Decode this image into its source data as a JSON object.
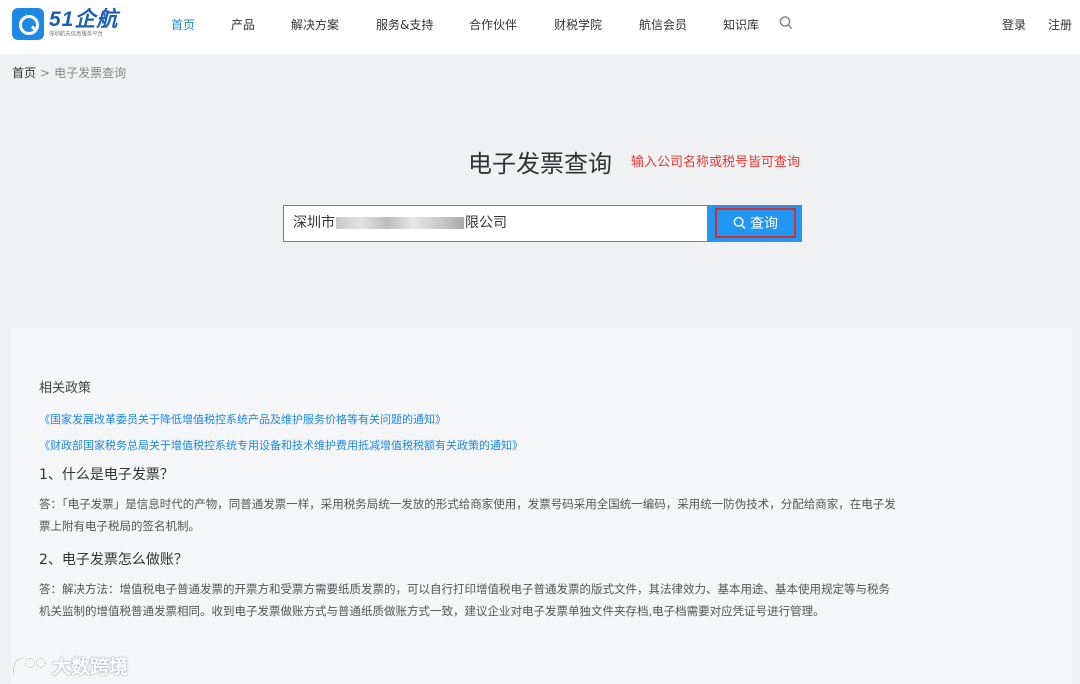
{
  "header": {
    "logo": {
      "name": "51企航",
      "subtitle": "深圳航天信息服务平台"
    },
    "nav": [
      {
        "label": "首页",
        "active": true
      },
      {
        "label": "产品"
      },
      {
        "label": "解决方案"
      },
      {
        "label": "服务&支持"
      },
      {
        "label": "合作伙伴"
      },
      {
        "label": "财税学院"
      },
      {
        "label": "航信会员"
      },
      {
        "label": "知识库"
      }
    ],
    "login_label": "登录",
    "register_label": "注册"
  },
  "breadcrumb": {
    "home": "首页",
    "separator": ">",
    "current": "电子发票查询"
  },
  "search": {
    "title": "电子发票查询",
    "hint": "输入公司名称或税号皆可查询",
    "value_prefix": "深圳市",
    "value_suffix": "限公司",
    "button_label": "查询"
  },
  "policy": {
    "heading": "相关政策",
    "links": [
      "《国家发展改革委员关于降低增值税控系统产品及维护服务价格等有关问题的通知》",
      "《财政部国家税务总局关于增值税控系统专用设备和技术维护费用抵减增值税税额有关政策的通知》"
    ],
    "faqs": [
      {
        "question": "1、什么是电子发票？",
        "answer": "答：「电子发票」是信息时代的产物，同普通发票一样，采用税务局统一发放的形式给商家使用，发票号码采用全国统一编码，采用统一防伪技术，分配给商家，在电子发票上附有电子税局的签名机制。"
      },
      {
        "question": "2、电子发票怎么做账？",
        "answer": "答：解决方法：增值税电子普通发票的开票方和受票方需要纸质发票的，可以自行打印增值税电子普通发票的版式文件，其法律效力、基本用途、基本使用规定等与税务机关监制的增值税普通发票相同。收到电子发票做账方式与普通纸质做账方式一致，建议企业对电子发票单独文件夹存档,电子档需要对应凭证号进行管理。"
      }
    ]
  },
  "watermark": "大数跨境",
  "colors": {
    "accent": "#1e88e5",
    "hint_red": "#e53935",
    "button_blue": "#2196f3"
  }
}
